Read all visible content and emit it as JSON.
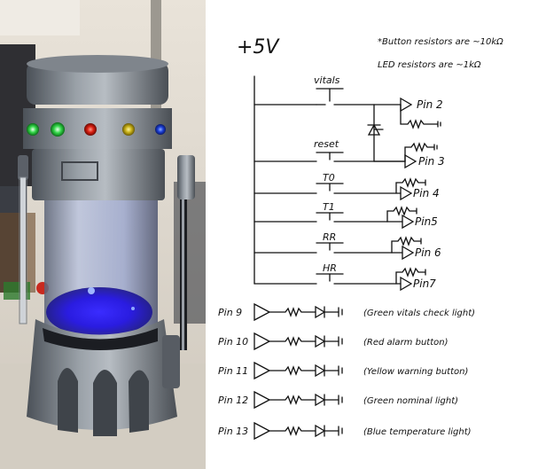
{
  "schematic": {
    "supply_label": "+5V",
    "notes": [
      "*Button resistors are ~10kΩ",
      "LED resistors are ~1kΩ"
    ],
    "switches": [
      {
        "label": "vitals"
      },
      {
        "label": "reset"
      },
      {
        "label": "T0"
      },
      {
        "label": "T1"
      },
      {
        "label": "RR"
      },
      {
        "label": "HR"
      }
    ],
    "pins_in": [
      "Pin 2",
      "Pin 3",
      "Pin 4",
      "Pin5",
      "Pin 6",
      "Pin7"
    ],
    "leds": [
      {
        "pin": "Pin 9",
        "desc": "(Green vitals check light)"
      },
      {
        "pin": "Pin 10",
        "desc": "(Red alarm button)"
      },
      {
        "pin": "Pin 11",
        "desc": "(Yellow warning button)"
      },
      {
        "pin": "Pin 12",
        "desc": "(Green nominal light)"
      },
      {
        "pin": "Pin 13",
        "desc": "(Blue temperature light)"
      }
    ]
  },
  "colors": {
    "led_green": "#34d84a",
    "led_red": "#d81e10",
    "led_yellow": "#c8b118",
    "led_blue": "#1c3fd6",
    "glow_blue": "#2a1ce0"
  }
}
